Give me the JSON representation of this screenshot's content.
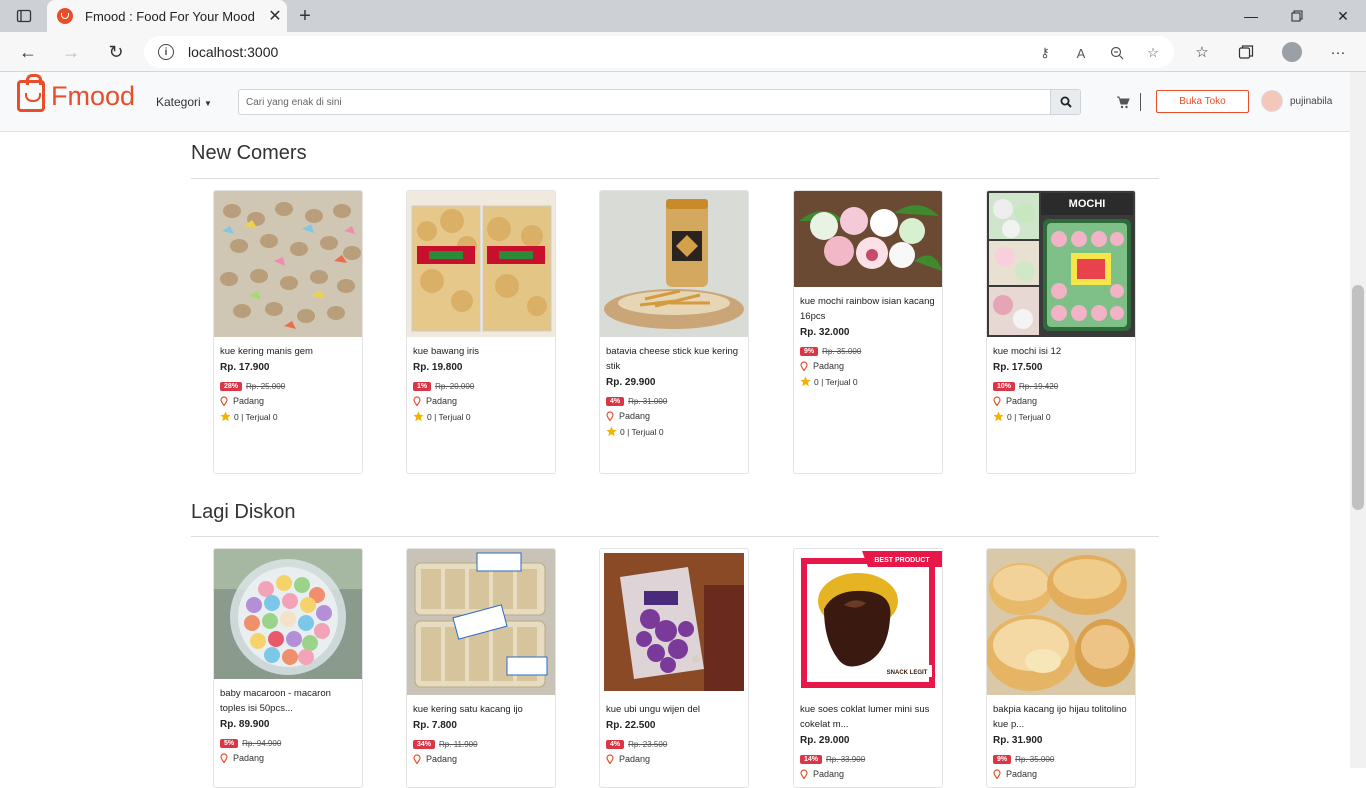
{
  "browser": {
    "tab_title": "Fmood : Food For Your Mood",
    "url": "localhost:3000"
  },
  "header": {
    "logo_text": "Fmood",
    "kategori_label": "Kategori",
    "search_placeholder": "Cari yang enak di sini",
    "buka_toko_label": "Buka Toko",
    "username": "pujinabila",
    "accent_color": "#e84e2a"
  },
  "sections": [
    {
      "title": "New Comers",
      "products": [
        {
          "name": "kue kering manis gem",
          "price": "Rp. 17.900",
          "discount": "28%",
          "old_price": "Rp. 25.000",
          "location": "Padang",
          "stat": "0 | Terjual 0"
        },
        {
          "name": "kue bawang iris",
          "price": "Rp. 19.800",
          "discount": "1%",
          "old_price": "Rp. 20.000",
          "location": "Padang",
          "stat": "0 | Terjual 0"
        },
        {
          "name": "batavia cheese stick kue kering stik",
          "price": "Rp. 29.900",
          "discount": "4%",
          "old_price": "Rp. 31.000",
          "location": "Padang",
          "stat": "0 | Terjual 0"
        },
        {
          "name": "kue mochi rainbow isian kacang 16pcs",
          "price": "Rp. 32.000",
          "discount": "9%",
          "old_price": "Rp. 35.000",
          "location": "Padang",
          "stat": "0 | Terjual 0"
        },
        {
          "name": "kue mochi isi 12",
          "price": "Rp. 17.500",
          "discount": "10%",
          "old_price": "Rp. 19.420",
          "location": "Padang",
          "stat": "0 | Terjual 0"
        }
      ]
    },
    {
      "title": "Lagi Diskon",
      "products": [
        {
          "name": "baby macaroon - macaron toples isi 50pcs...",
          "price": "Rp. 89.900",
          "discount": "5%",
          "old_price": "Rp. 94.900",
          "location": "Padang"
        },
        {
          "name": "kue kering satu kacang ijo",
          "price": "Rp. 7.800",
          "discount": "34%",
          "old_price": "Rp. 11.900",
          "location": "Padang"
        },
        {
          "name": "kue ubi ungu wijen del",
          "price": "Rp. 22.500",
          "discount": "4%",
          "old_price": "Rp. 23.500",
          "location": "Padang"
        },
        {
          "name": "kue soes coklat lumer mini sus cokelat m...",
          "price": "Rp. 29.000",
          "discount": "14%",
          "old_price": "Rp. 33.900",
          "location": "Padang"
        },
        {
          "name": "bakpia kacang ijo hijau tolitolino kue p...",
          "price": "Rp. 31.900",
          "discount": "9%",
          "old_price": "Rp. 35.000",
          "location": "Padang"
        }
      ]
    }
  ],
  "image_labels": {
    "mochi_title": "MOCHI",
    "best_product": "BEST PRODUCT",
    "snack_legit": "SNACK LEGIT"
  }
}
